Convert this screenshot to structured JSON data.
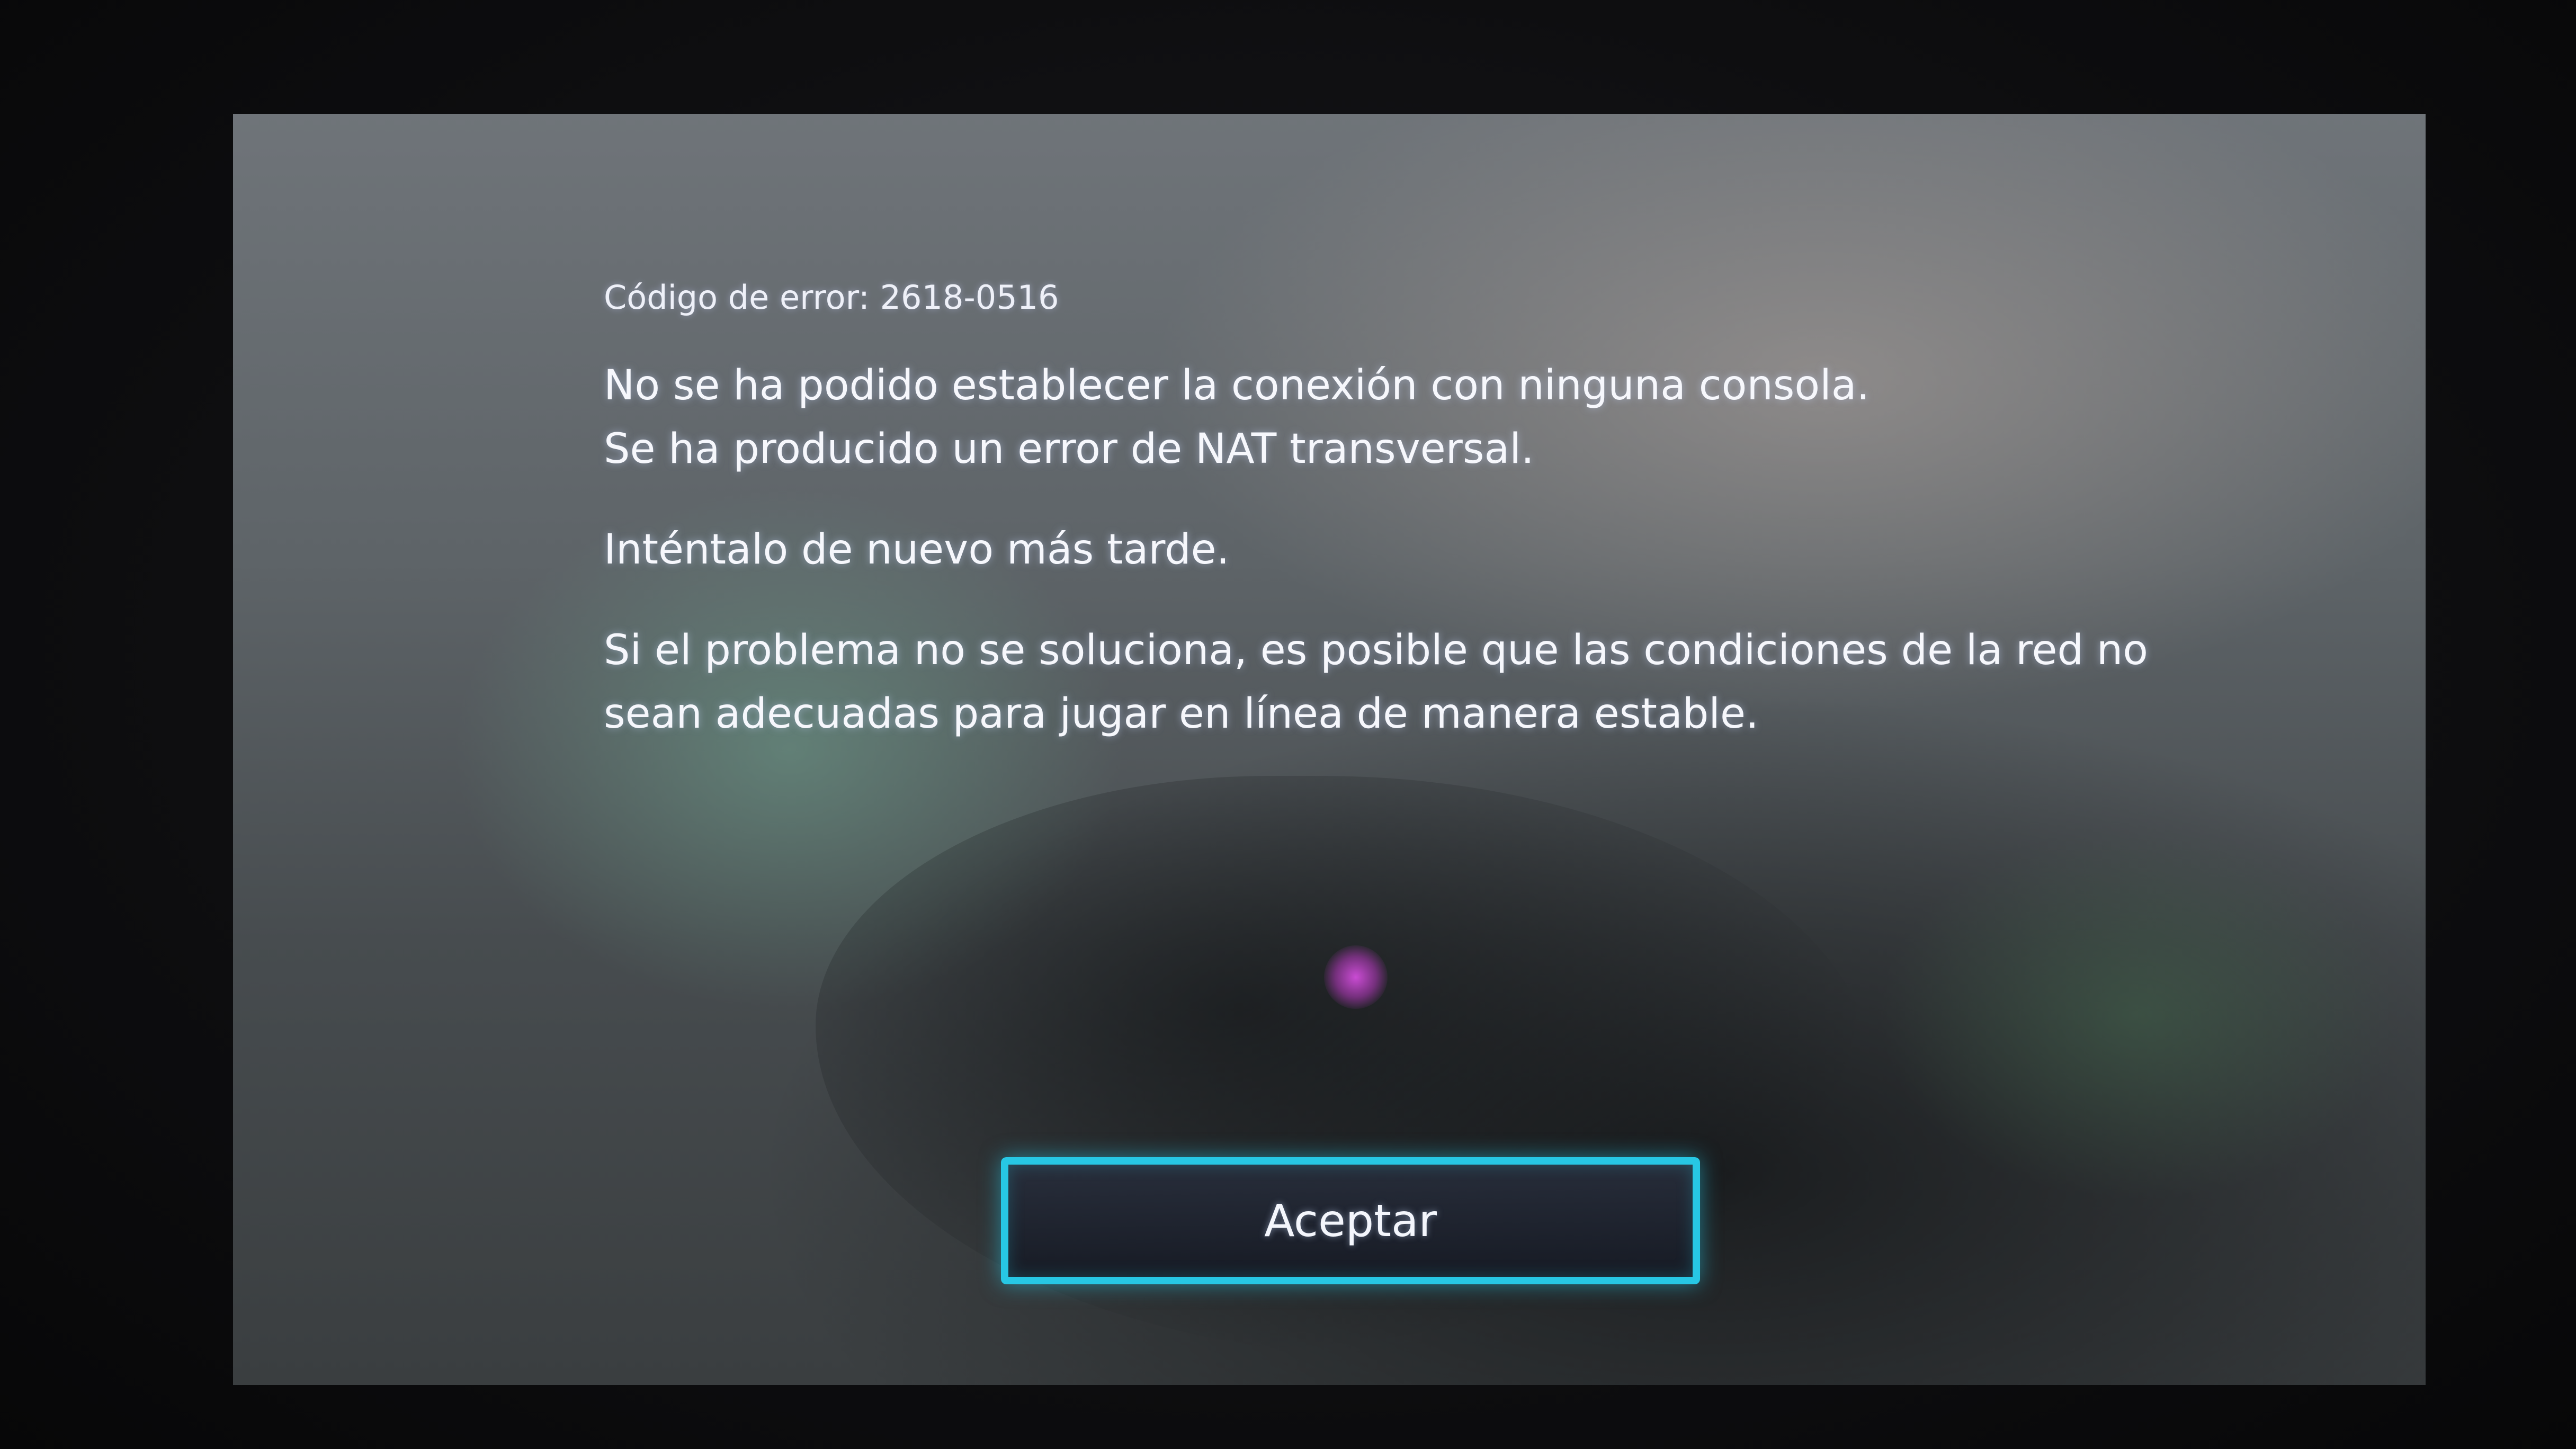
{
  "dialog": {
    "error_code": "Código de error: 2618-0516",
    "line1": "No se ha podido establecer la conexión con ninguna consola.",
    "line2": "Se ha producido un error de NAT transversal.",
    "retry": "Inténtalo de nuevo más tarde.",
    "hint_line1": "Si el problema no se soluciona, es posible que las condiciones de la red no",
    "hint_line2": "sean adecuadas para jugar en línea de manera estable.",
    "accept_label": "Aceptar"
  },
  "colors": {
    "button_border": "#27c7e4",
    "text": "#f4f5fb"
  }
}
